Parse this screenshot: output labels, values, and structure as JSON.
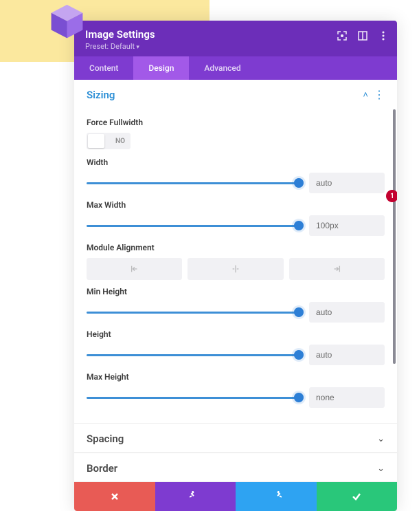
{
  "header": {
    "title": "Image Settings",
    "preset": "Preset: Default"
  },
  "tabs": [
    {
      "label": "Content",
      "active": false
    },
    {
      "label": "Design",
      "active": true
    },
    {
      "label": "Advanced",
      "active": false
    }
  ],
  "sections": {
    "sizing": {
      "title": "Sizing",
      "open": true,
      "fields": {
        "force_fullwidth": {
          "label": "Force Fullwidth",
          "value": "NO"
        },
        "width": {
          "label": "Width",
          "value": "auto"
        },
        "max_width": {
          "label": "Max Width",
          "value": "100px"
        },
        "module_alignment": {
          "label": "Module Alignment"
        },
        "min_height": {
          "label": "Min Height",
          "value": "auto"
        },
        "height": {
          "label": "Height",
          "value": "auto"
        },
        "max_height": {
          "label": "Max Height",
          "value": "none"
        }
      }
    },
    "spacing": {
      "title": "Spacing",
      "open": false
    },
    "border": {
      "title": "Border",
      "open": false
    }
  },
  "badge": "1",
  "colors": {
    "header": "#6c2eb9",
    "tabbar": "#7e3bd0",
    "active_tab": "#a259e8",
    "accent": "#2d8fd6"
  }
}
